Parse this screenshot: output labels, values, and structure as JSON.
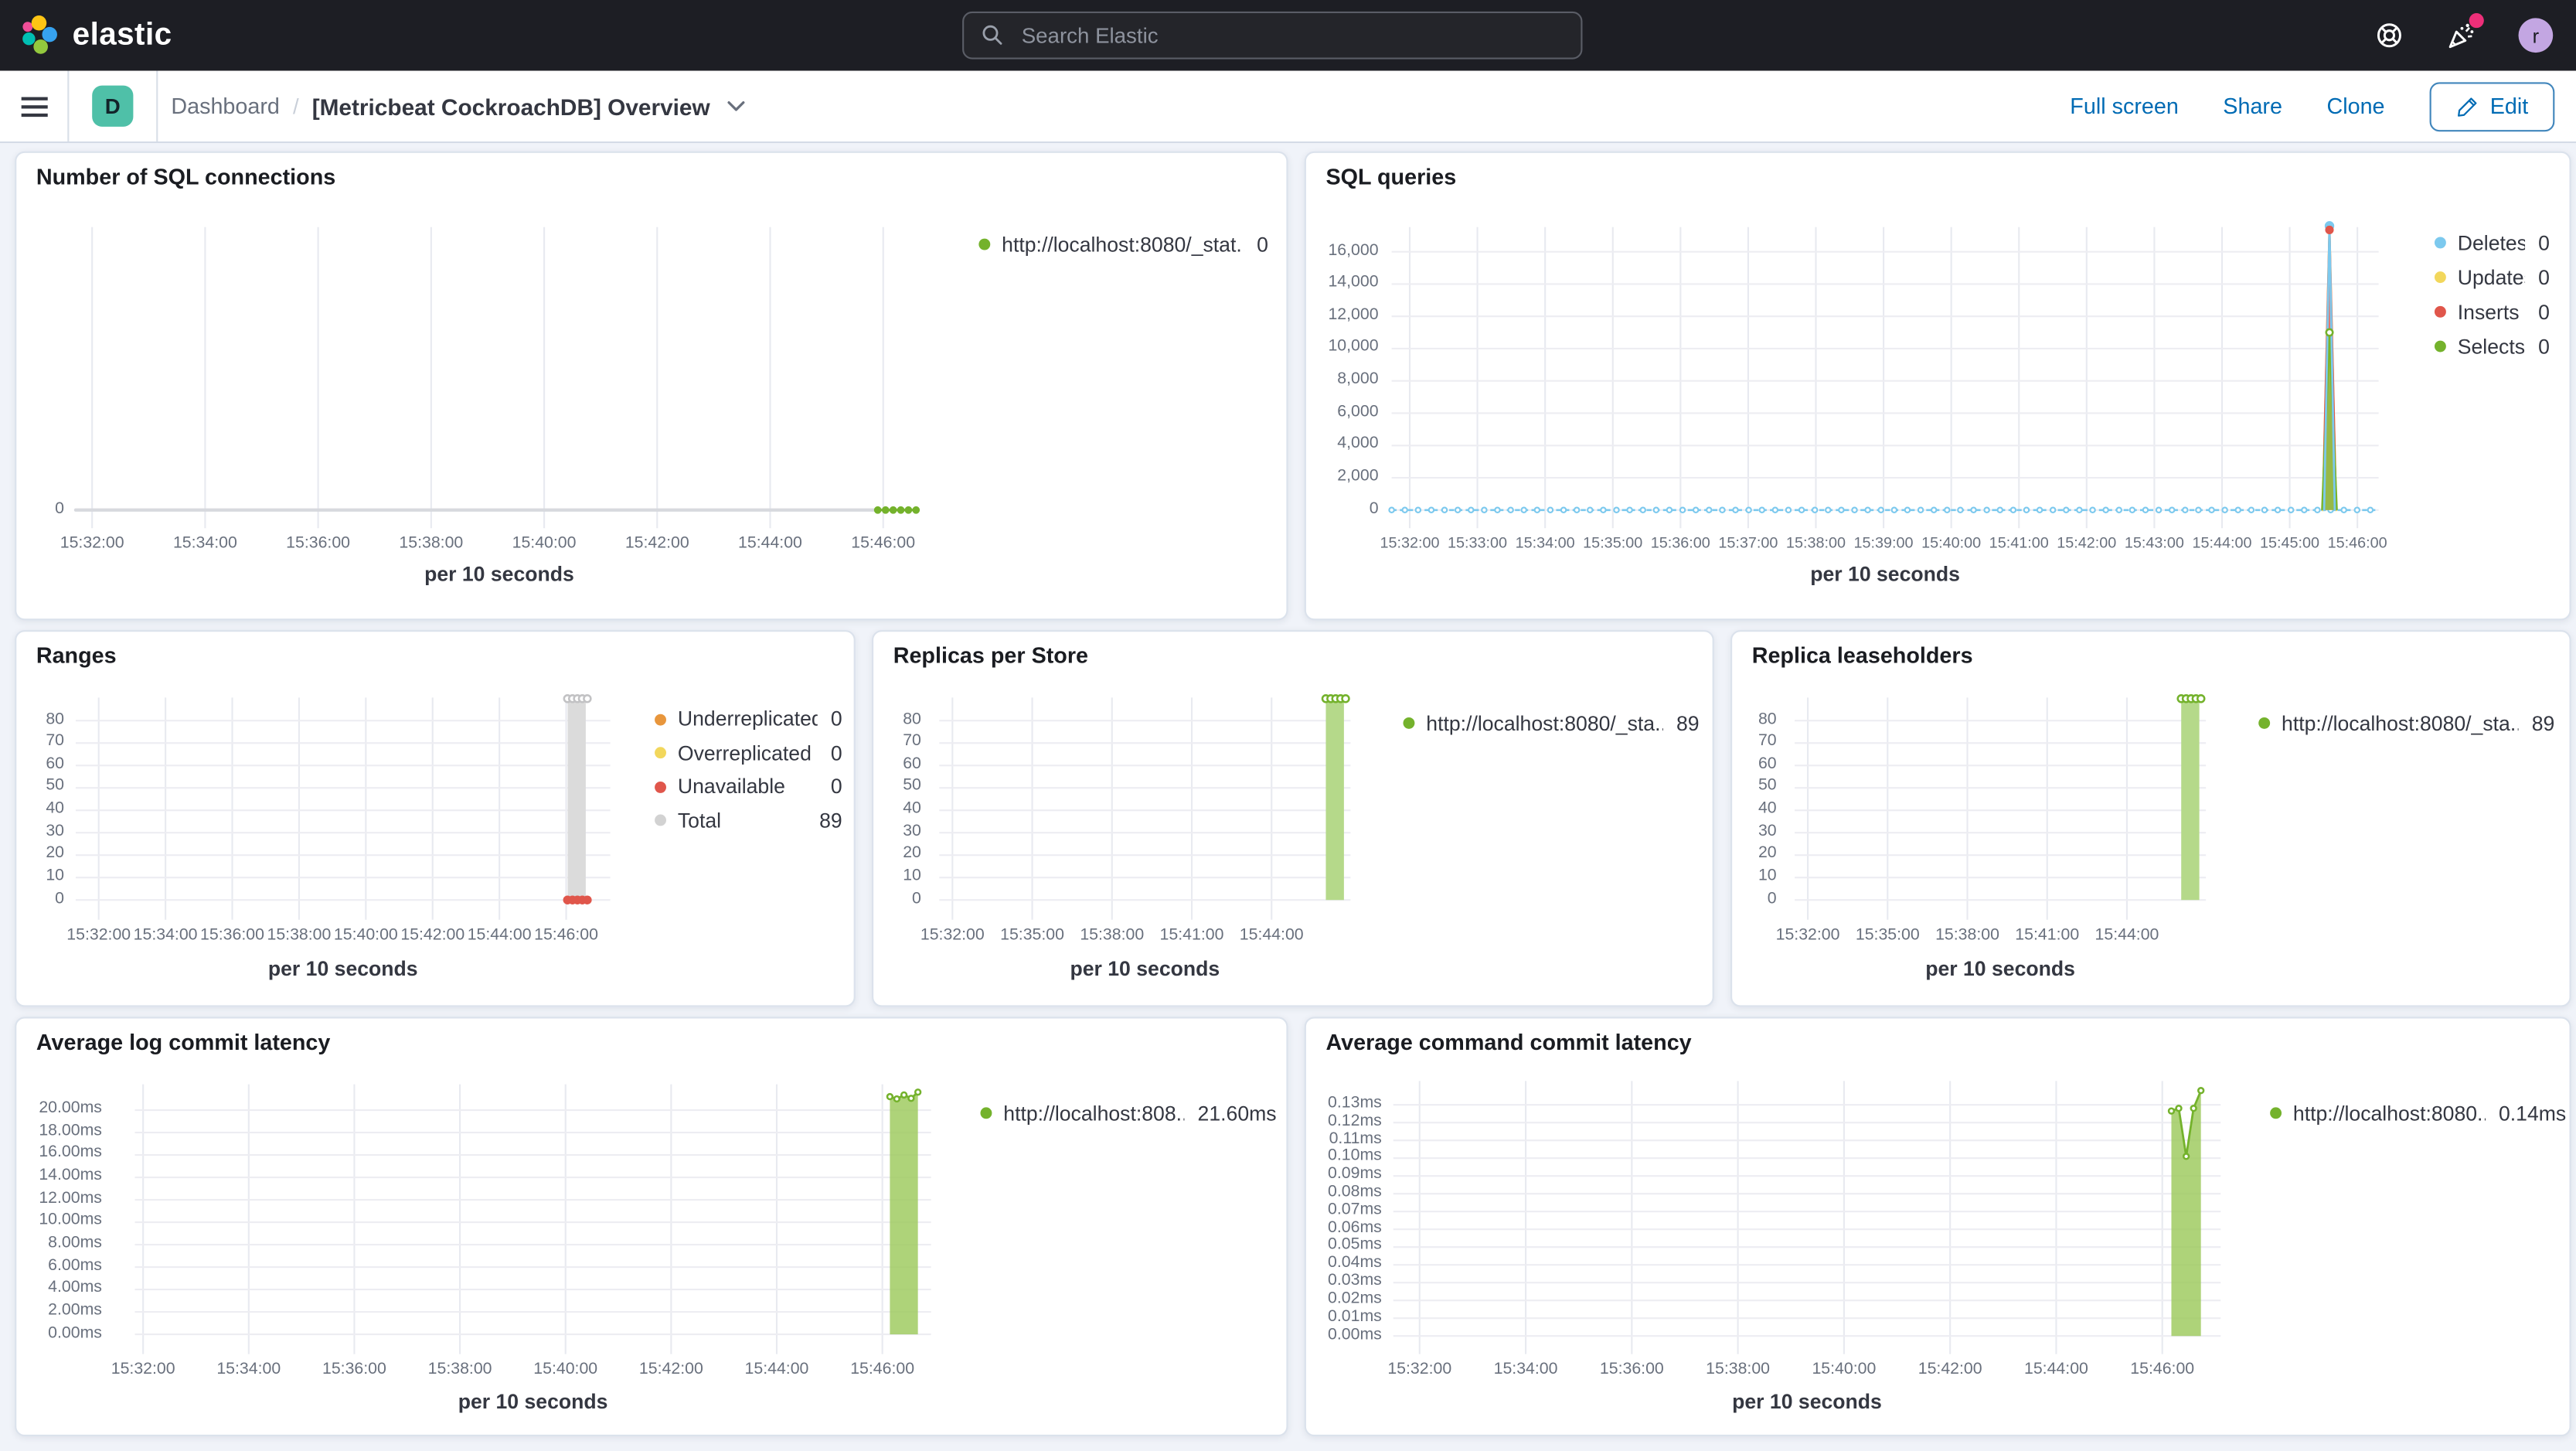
{
  "header": {
    "logo": "elastic",
    "search_placeholder": "Search Elastic",
    "user_initial": "r"
  },
  "toolbar": {
    "space_initial": "D",
    "breadcrumb": {
      "root": "Dashboard",
      "separator": "/",
      "current": "[Metricbeat CockroachDB] Overview"
    },
    "actions": [
      {
        "label": "Full screen"
      },
      {
        "label": "Share"
      },
      {
        "label": "Clone"
      }
    ],
    "edit_label": "Edit"
  },
  "panels": [
    {
      "id": "sql-connections",
      "title": "Number of SQL connections",
      "type": "line",
      "xlabel": "per 10 seconds",
      "xticks": [
        "15:32:00",
        "15:34:00",
        "15:36:00",
        "15:38:00",
        "15:40:00",
        "15:42:00",
        "15:44:00",
        "15:46:00"
      ],
      "yticks": [
        {
          "v": 0,
          "label": "0"
        }
      ],
      "ylim": [
        0,
        1
      ],
      "legend": [
        {
          "color": "#74B22C",
          "label": "http://localhost:8080/_stat...",
          "value": "0"
        }
      ],
      "series": [
        {
          "type": "line",
          "color": "#D7D9DE",
          "width": 2,
          "points": [
            [
              0,
              0
            ],
            [
              0.9468,
              0
            ]
          ]
        },
        {
          "type": "line",
          "color": "#74B22C",
          "width": 1.4,
          "points": [
            [
              0.9468,
              0
            ],
            [
              0.992,
              0
            ]
          ]
        },
        {
          "type": "dots",
          "color": "#74B22C",
          "r": 1.7,
          "points": [
            [
              0.9468,
              0
            ],
            [
              0.956,
              0
            ],
            [
              0.965,
              0
            ],
            [
              0.974,
              0
            ],
            [
              0.983,
              0
            ],
            [
              0.992,
              0
            ]
          ]
        }
      ]
    },
    {
      "id": "sql-queries",
      "title": "SQL queries",
      "type": "line",
      "xlabel": "per 10 seconds",
      "xticks": [
        "15:32:00",
        "15:33:00",
        "15:34:00",
        "15:35:00",
        "15:36:00",
        "15:37:00",
        "15:38:00",
        "15:39:00",
        "15:40:00",
        "15:41:00",
        "15:42:00",
        "15:43:00",
        "15:44:00",
        "15:45:00",
        "15:46:00"
      ],
      "yticks": [
        {
          "v": 0,
          "label": "0"
        },
        {
          "v": 2000,
          "label": "2,000"
        },
        {
          "v": 4000,
          "label": "4,000"
        },
        {
          "v": 6000,
          "label": "6,000"
        },
        {
          "v": 8000,
          "label": "8,000"
        },
        {
          "v": 10000,
          "label": "10,000"
        },
        {
          "v": 12000,
          "label": "12,000"
        },
        {
          "v": 14000,
          "label": "14,000"
        },
        {
          "v": 16000,
          "label": "16,000"
        }
      ],
      "ylim": [
        0,
        17500
      ],
      "legend": [
        {
          "color": "#7CC9EE",
          "label": "Deletes",
          "value": "0"
        },
        {
          "color": "#F2D75C",
          "label": "Updates",
          "value": "0"
        },
        {
          "color": "#E0564B",
          "label": "Inserts",
          "value": "0"
        },
        {
          "color": "#74B22C",
          "label": "Selects",
          "value": "0"
        }
      ],
      "series": [
        {
          "type": "dash",
          "color": "#7CC9EE",
          "y": 0,
          "x0": 0.0,
          "x1": 0.997,
          "step": 0.0134,
          "r": 1.5
        },
        {
          "type": "line",
          "color": "#F2D75C",
          "width": 1.4,
          "points": [
            [
              0.9435,
              0
            ],
            [
              0.9502,
              17250
            ],
            [
              0.9569,
              0
            ]
          ]
        },
        {
          "type": "area",
          "stroke": "#E0564B",
          "fill": "rgba(224,90,78,0.85)",
          "points": [
            [
              0.9435,
              0
            ],
            [
              0.9502,
              17350
            ],
            [
              0.9569,
              0
            ]
          ]
        },
        {
          "type": "area",
          "stroke": "#79B42A",
          "fill": "rgba(142,193,70,0.9)",
          "points": [
            [
              0.9428,
              0
            ],
            [
              0.9502,
              11000
            ],
            [
              0.9576,
              0
            ]
          ]
        },
        {
          "type": "line",
          "color": "#7CC9EE",
          "width": 1.3,
          "points": [
            [
              0.9448,
              0
            ],
            [
              0.9502,
              17600
            ],
            [
              0.9556,
              0
            ]
          ]
        },
        {
          "type": "dots",
          "color": "#7CC9EE",
          "r": 2.3,
          "points": [
            [
              0.9502,
              17600
            ]
          ]
        },
        {
          "type": "dots",
          "color": "#E0564B",
          "r": 2.0,
          "points": [
            [
              0.9502,
              17350
            ]
          ]
        },
        {
          "type": "dots",
          "color": "#74B22C",
          "open": true,
          "r": 2.0,
          "points": [
            [
              0.9502,
              11000
            ]
          ]
        }
      ]
    },
    {
      "id": "ranges",
      "title": "Ranges",
      "type": "line",
      "xlabel": "per 10 seconds",
      "xticks": [
        "15:32:00",
        "15:34:00",
        "15:36:00",
        "15:38:00",
        "15:40:00",
        "15:42:00",
        "15:44:00",
        "15:46:00"
      ],
      "yticks": [
        {
          "v": 0,
          "label": "0"
        },
        {
          "v": 10,
          "label": "10"
        },
        {
          "v": 20,
          "label": "20"
        },
        {
          "v": 30,
          "label": "30"
        },
        {
          "v": 40,
          "label": "40"
        },
        {
          "v": 50,
          "label": "50"
        },
        {
          "v": 60,
          "label": "60"
        },
        {
          "v": 70,
          "label": "70"
        },
        {
          "v": 80,
          "label": "80"
        }
      ],
      "ylim": [
        0,
        90
      ],
      "legend": [
        {
          "color": "#E8963C",
          "label": "Underreplicated",
          "value": "0"
        },
        {
          "color": "#F2D75C",
          "label": "Overreplicated",
          "value": "0"
        },
        {
          "color": "#E0564B",
          "label": "Unavailable",
          "value": "0"
        },
        {
          "color": "#D2D2D2",
          "label": "Total",
          "value": "89"
        }
      ],
      "series": [
        {
          "type": "bar",
          "fill": "#DBDBDB",
          "x": 0.9372,
          "wpx": 11,
          "v": 89
        },
        {
          "type": "dots",
          "color": "#C2C2C4",
          "open": true,
          "r": 2.1,
          "points": [
            [
              0.92,
              89.8
            ],
            [
              0.9293,
              89.8
            ],
            [
              0.9385,
              89.8
            ],
            [
              0.9477,
              89.8
            ],
            [
              0.957,
              89.8
            ]
          ]
        },
        {
          "type": "dots",
          "color": "#E0564B",
          "r": 2.1,
          "points": [
            [
              0.92,
              0
            ],
            [
              0.9293,
              0
            ],
            [
              0.9385,
              0
            ],
            [
              0.9477,
              0
            ],
            [
              0.957,
              0
            ]
          ]
        }
      ]
    },
    {
      "id": "replicas",
      "title": "Replicas per Store",
      "type": "bar",
      "xlabel": "per 10 seconds",
      "xticks": [
        "15:32:00",
        "15:35:00",
        "15:38:00",
        "15:41:00",
        "15:44:00"
      ],
      "yticks": [
        {
          "v": 0,
          "label": "0"
        },
        {
          "v": 10,
          "label": "10"
        },
        {
          "v": 20,
          "label": "20"
        },
        {
          "v": 30,
          "label": "30"
        },
        {
          "v": 40,
          "label": "40"
        },
        {
          "v": 50,
          "label": "50"
        },
        {
          "v": 60,
          "label": "60"
        },
        {
          "v": 70,
          "label": "70"
        },
        {
          "v": 80,
          "label": "80"
        }
      ],
      "ylim": [
        0,
        90
      ],
      "legend": [
        {
          "color": "#74B22C",
          "label": "http://localhost:8080/_sta...",
          "value": "89"
        }
      ],
      "series": [
        {
          "type": "bar",
          "fill": "#B5D98A",
          "x": 0.962,
          "wpx": 11,
          "v": 89
        },
        {
          "type": "dots",
          "color": "#74B22C",
          "open": true,
          "r": 2.1,
          "points": [
            [
              0.94,
              89.8
            ],
            [
              0.952,
              89.8
            ],
            [
              0.964,
              89.8
            ],
            [
              0.976,
              89.8
            ],
            [
              0.988,
              89.8
            ]
          ]
        }
      ]
    },
    {
      "id": "leaseholders",
      "title": "Replica leaseholders",
      "type": "bar",
      "xlabel": "per 10 seconds",
      "xticks": [
        "15:32:00",
        "15:35:00",
        "15:38:00",
        "15:41:00",
        "15:44:00"
      ],
      "yticks": [
        {
          "v": 0,
          "label": "0"
        },
        {
          "v": 10,
          "label": "10"
        },
        {
          "v": 20,
          "label": "20"
        },
        {
          "v": 30,
          "label": "30"
        },
        {
          "v": 40,
          "label": "40"
        },
        {
          "v": 50,
          "label": "50"
        },
        {
          "v": 60,
          "label": "60"
        },
        {
          "v": 70,
          "label": "70"
        },
        {
          "v": 80,
          "label": "80"
        }
      ],
      "ylim": [
        0,
        90
      ],
      "legend": [
        {
          "color": "#74B22C",
          "label": "http://localhost:8080/_sta...",
          "value": "89"
        }
      ],
      "series": [
        {
          "type": "bar",
          "fill": "#B5D98A",
          "x": 0.962,
          "wpx": 11,
          "v": 89
        },
        {
          "type": "dots",
          "color": "#74B22C",
          "open": true,
          "r": 2.1,
          "points": [
            [
              0.94,
              89.8
            ],
            [
              0.952,
              89.8
            ],
            [
              0.964,
              89.8
            ],
            [
              0.976,
              89.8
            ],
            [
              0.988,
              89.8
            ]
          ]
        }
      ]
    },
    {
      "id": "log-latency",
      "title": "Average log commit latency",
      "type": "area",
      "xlabel": "per 10 seconds",
      "xticks": [
        "15:32:00",
        "15:34:00",
        "15:36:00",
        "15:38:00",
        "15:40:00",
        "15:42:00",
        "15:44:00",
        "15:46:00"
      ],
      "yticks": [
        {
          "v": 0,
          "label": "0.00ms"
        },
        {
          "v": 2,
          "label": "2.00ms"
        },
        {
          "v": 4,
          "label": "4.00ms"
        },
        {
          "v": 6,
          "label": "6.00ms"
        },
        {
          "v": 8,
          "label": "8.00ms"
        },
        {
          "v": 10,
          "label": "10.00ms"
        },
        {
          "v": 12,
          "label": "12.00ms"
        },
        {
          "v": 14,
          "label": "14.00ms"
        },
        {
          "v": 16,
          "label": "16.00ms"
        },
        {
          "v": 18,
          "label": "18.00ms"
        },
        {
          "v": 20,
          "label": "20.00ms"
        }
      ],
      "ylim": [
        0,
        22.3
      ],
      "legend": [
        {
          "color": "#74B22C",
          "label": "http://localhost:808...",
          "value": "21.60ms"
        }
      ],
      "series": [
        {
          "type": "area",
          "stroke": "#74B22C",
          "fill": "rgba(154,200,88,0.8)",
          "points": [
            [
              0.9483,
              21.2
            ],
            [
              0.957,
              21.0
            ],
            [
              0.966,
              21.35
            ],
            [
              0.975,
              21.05
            ],
            [
              0.9835,
              21.6
            ]
          ]
        },
        {
          "type": "dots",
          "color": "#74B22C",
          "open": true,
          "r": 1.6,
          "points": [
            [
              0.9483,
              21.2
            ],
            [
              0.957,
              21.0
            ],
            [
              0.966,
              21.35
            ],
            [
              0.975,
              21.05
            ],
            [
              0.9835,
              21.6
            ]
          ]
        }
      ]
    },
    {
      "id": "cmd-latency",
      "title": "Average command commit latency",
      "type": "area",
      "xlabel": "per 10 seconds",
      "xticks": [
        "15:32:00",
        "15:34:00",
        "15:36:00",
        "15:38:00",
        "15:40:00",
        "15:42:00",
        "15:44:00",
        "15:46:00"
      ],
      "yticks": [
        {
          "v": 0.0,
          "label": "0.00ms"
        },
        {
          "v": 0.01,
          "label": "0.01ms"
        },
        {
          "v": 0.02,
          "label": "0.02ms"
        },
        {
          "v": 0.03,
          "label": "0.03ms"
        },
        {
          "v": 0.04,
          "label": "0.04ms"
        },
        {
          "v": 0.05,
          "label": "0.05ms"
        },
        {
          "v": 0.06,
          "label": "0.06ms"
        },
        {
          "v": 0.07,
          "label": "0.07ms"
        },
        {
          "v": 0.08,
          "label": "0.08ms"
        },
        {
          "v": 0.09,
          "label": "0.09ms"
        },
        {
          "v": 0.1,
          "label": "0.10ms"
        },
        {
          "v": 0.11,
          "label": "0.11ms"
        },
        {
          "v": 0.12,
          "label": "0.12ms"
        },
        {
          "v": 0.13,
          "label": "0.13ms"
        }
      ],
      "ylim": [
        0,
        0.1434
      ],
      "legend": [
        {
          "color": "#74B22C",
          "label": "http://localhost:8080...",
          "value": "0.14ms"
        }
      ],
      "series": [
        {
          "type": "area",
          "stroke": "#74B22C",
          "fill": "rgba(154,200,88,0.8)",
          "points": [
            [
              0.9404,
              0.1265
            ],
            [
              0.9493,
              0.128
            ],
            [
              0.9583,
              0.101
            ],
            [
              0.9672,
              0.128
            ],
            [
              0.9761,
              0.138
            ]
          ]
        },
        {
          "type": "dots",
          "color": "#74B22C",
          "open": true,
          "r": 1.6,
          "points": [
            [
              0.9404,
              0.1265
            ],
            [
              0.9493,
              0.128
            ],
            [
              0.9583,
              0.101
            ],
            [
              0.9672,
              0.128
            ],
            [
              0.9761,
              0.138
            ]
          ]
        }
      ]
    }
  ]
}
